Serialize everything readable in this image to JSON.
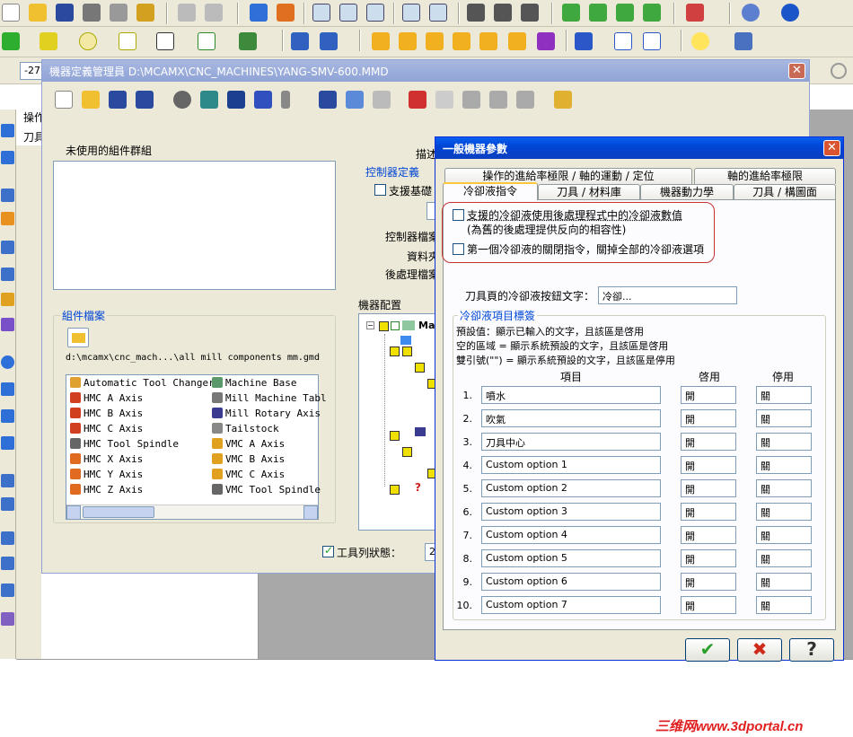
{
  "toolbar": {
    "coord_value": "-27."
  },
  "left_panel": {
    "tab_ops": "操作",
    "tab_tool": "刀具"
  },
  "machine_manager": {
    "title": "機器定義管理員 D:\\MCAMX\\CNC_MACHINES\\YANG-SMV-600.MMD",
    "close_label": "✕",
    "unused_groups_label": "未使用的組件群組",
    "description_label": "描述",
    "control_def_label": "控制器定義",
    "support_label": "支援基礎",
    "control_file_label": "控制器檔案",
    "data_label": "資料夾",
    "post_file_label": "後處理檔案",
    "component_files_label": "組件檔案",
    "component_path": "d:\\mcamx\\cnc_mach...\\all mill components mm.gmd",
    "components_left": [
      "Automatic Tool Changer",
      "HMC A Axis",
      "HMC B Axis",
      "HMC C Axis",
      "HMC Tool Spindle",
      "HMC X Axis",
      "HMC Y Axis",
      "HMC Z Axis"
    ],
    "components_right": [
      "Machine Base",
      "Mill Machine Tabl",
      "Mill Rotary Axis",
      "Tailstock",
      "VMC A Axis",
      "VMC B Axis",
      "VMC C Axis",
      "VMC Tool Spindle"
    ],
    "machine_config_label": "機器配置",
    "tree_root_label": "Mac",
    "toolbar_status_label": "工具列狀態：",
    "toolbar_status_value": "2"
  },
  "general_params": {
    "title": "一般機器參數",
    "close_label": "✕",
    "tabs_row1": [
      "操作的進給率極限 / 軸的運動 / 定位",
      "軸的進給率極限"
    ],
    "tabs_row2": [
      "冷卻液指令",
      "刀具 / 材料庫",
      "機器動力學",
      "刀具 / 構圖面"
    ],
    "chk_support_post": "支援的冷卻液使用後處理程式中的冷卻液數值",
    "chk_support_post_note": "(為舊的後處理提供反向的相容性)",
    "chk_first_off": "第一個冷卻液的關閉指令，關掉全部的冷卻液選項",
    "button_text_label": "刀具頁的冷卻液按鈕文字：",
    "button_text_value": "冷卻...",
    "labels_group": "冷卻液項目標簽",
    "help_line1": "預設值：顯示已輸入的文字，且該區是啓用",
    "help_line2": "空的區域 = 顯示系統預設的文字，且該區是啓用",
    "help_line3": "雙引號(\"\") = 顯示系統預設的文字，且該區是停用",
    "col_item": "項目",
    "col_on": "啓用",
    "col_off": "停用",
    "rows": [
      {
        "num": "1.",
        "item": "噴水",
        "on": "開",
        "off": "關"
      },
      {
        "num": "2.",
        "item": "吹氣",
        "on": "開",
        "off": "關"
      },
      {
        "num": "3.",
        "item": "刀具中心",
        "on": "開",
        "off": "關"
      },
      {
        "num": "4.",
        "item": "Custom option 1",
        "on": "開",
        "off": "關"
      },
      {
        "num": "5.",
        "item": "Custom option 2",
        "on": "開",
        "off": "關"
      },
      {
        "num": "6.",
        "item": "Custom option 3",
        "on": "開",
        "off": "關"
      },
      {
        "num": "7.",
        "item": "Custom option 4",
        "on": "開",
        "off": "關"
      },
      {
        "num": "8.",
        "item": "Custom option 5",
        "on": "開",
        "off": "關"
      },
      {
        "num": "9.",
        "item": "Custom option 6",
        "on": "開",
        "off": "關"
      },
      {
        "num": "10.",
        "item": "Custom option 7",
        "on": "開",
        "off": "關"
      }
    ],
    "ok_label": "✔",
    "cancel_label": "✖",
    "help_label": "?"
  },
  "watermark": "三维网www.3dportal.cn"
}
